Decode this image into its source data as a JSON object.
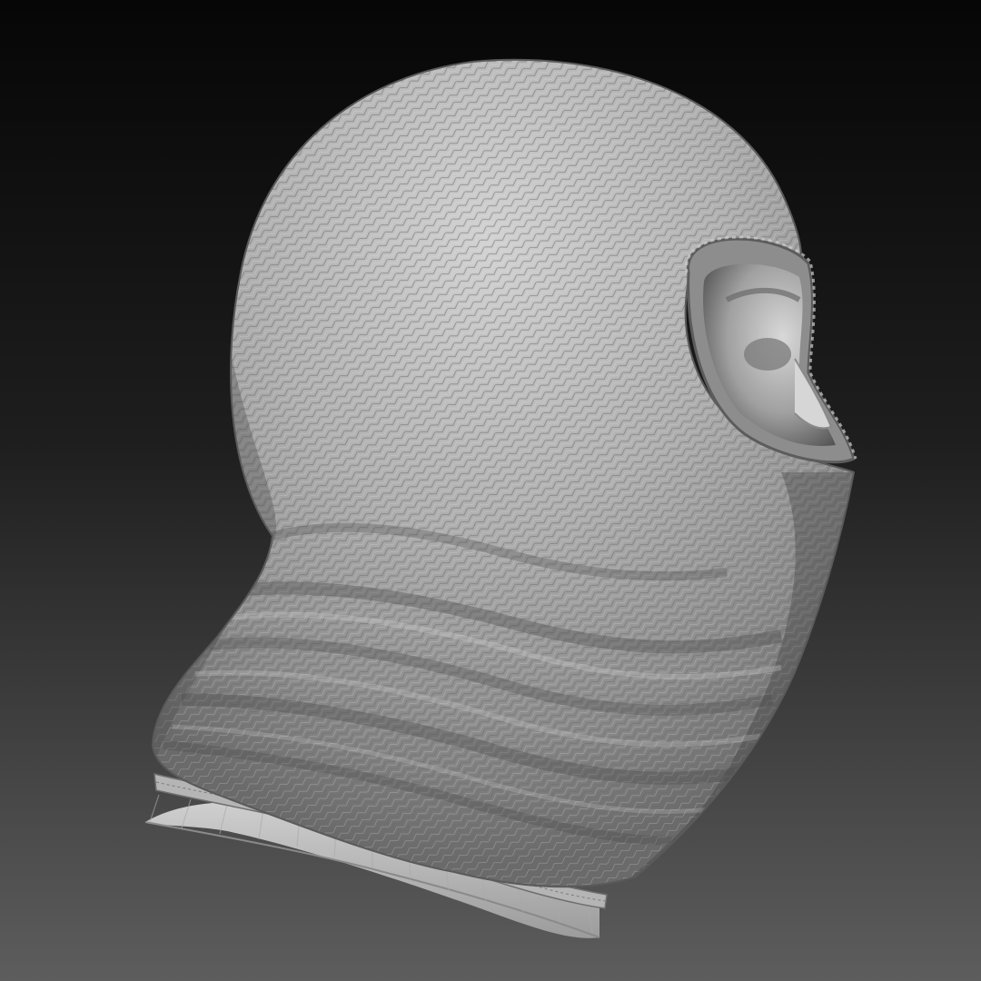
{
  "render": {
    "subject": "balaclava-sculpt",
    "colors": {
      "bg_top": "#070707",
      "bg_bottom": "#5c5c5c",
      "material_light": "#c9c9c9",
      "material_mid": "#8e8e8e",
      "material_dark": "#3c3c3c",
      "knit_line": "#6e6e6e"
    }
  }
}
